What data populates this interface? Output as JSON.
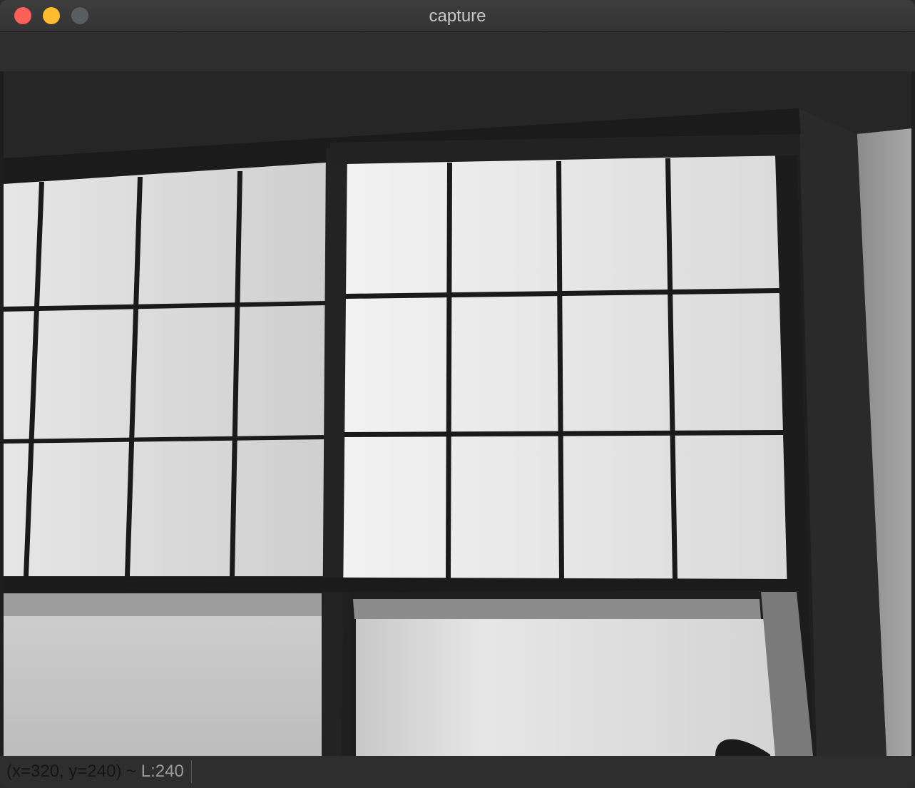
{
  "window": {
    "title": "capture"
  },
  "statusbar": {
    "coords": "(x=320, y=240) ~",
    "level": " L:240"
  },
  "colors": {
    "close": "#fe5f57",
    "minimize": "#febc2e",
    "zoom": "#5a5d61"
  },
  "icons": {
    "close": "close-traffic-light",
    "minimize": "minimize-traffic-light",
    "zoom": "zoom-traffic-light"
  }
}
